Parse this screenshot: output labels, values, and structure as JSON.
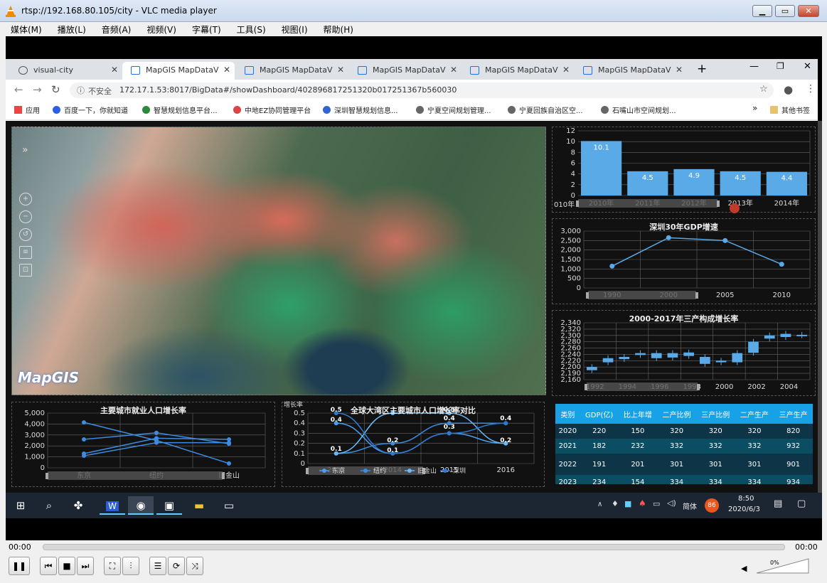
{
  "vlc": {
    "title": "rtsp://192.168.80.105/city - VLC media player",
    "menu": [
      "媒体(M)",
      "播放(L)",
      "音频(A)",
      "视频(V)",
      "字幕(T)",
      "工具(S)",
      "视图(I)",
      "帮助(H)"
    ],
    "time_left": "00:00",
    "time_right": "00:00",
    "volume": "0%"
  },
  "chrome": {
    "tabs": [
      {
        "label": "visual-city"
      },
      {
        "label": "MapGIS MapDataV"
      },
      {
        "label": "MapGIS MapDataV"
      },
      {
        "label": "MapGIS MapDataV"
      },
      {
        "label": "MapGIS MapDataV"
      },
      {
        "label": "MapGIS MapDataV"
      }
    ],
    "insecure": "不安全",
    "url": "172.17.1.53:8017/BigData#/showDashboard/402896817251320b017251367b560030",
    "bookmarks": [
      "应用",
      "百度一下，你就知道",
      "智慧规划信息平台...",
      "中地EZ协同管理平台",
      "深圳智慧规划信息...",
      "宁夏空间规划管理...",
      "宁夏回族自治区空...",
      "石嘴山市空间规划..."
    ],
    "more": "»",
    "other_bookmarks": "其他书签"
  },
  "map": {
    "logo": "MapGIS",
    "expand": "»"
  },
  "chart1": {
    "chart_data": {
      "type": "bar",
      "categories": [
        "2010年",
        "2011年",
        "2012年",
        "2013年",
        "2014年"
      ],
      "values": [
        10.1,
        4.5,
        4.9,
        4.5,
        4.4
      ],
      "ylim": [
        0,
        12
      ],
      "yticks": [
        "12",
        "10",
        "8",
        "6",
        "4",
        "2",
        "0"
      ]
    },
    "slider_label": "010年",
    "slider_label2": "2014年"
  },
  "chart2": {
    "title": "深圳30年GDP增速",
    "chart_data": {
      "type": "line",
      "categories": [
        "1990",
        "2000",
        "2005",
        "2010"
      ],
      "values": [
        1150,
        2650,
        2500,
        1250
      ],
      "ylim": [
        0,
        3000
      ],
      "yticks": [
        "3,000",
        "2,500",
        "2,000",
        "1,500",
        "1,000",
        "500",
        "0"
      ]
    }
  },
  "chart3": {
    "title": "2000-2017年三产构成增长率",
    "chart_data": {
      "type": "candlestick",
      "xticks": [
        "1992",
        "1994",
        "1996",
        "1998",
        "2000",
        "2002",
        "2004"
      ],
      "ylim": [
        2160,
        2340
      ],
      "yticks": [
        "2,340",
        "2,320",
        "2,300",
        "2,280",
        "2,260",
        "2,240",
        "2,220",
        "2,200",
        "2,190",
        "2,160"
      ],
      "candles": [
        [
          2190,
          2200
        ],
        [
          2215,
          2228
        ],
        [
          2225,
          2232
        ],
        [
          2238,
          2244
        ],
        [
          2228,
          2244
        ],
        [
          2230,
          2244
        ],
        [
          2235,
          2246
        ],
        [
          2210,
          2232
        ],
        [
          2215,
          2220
        ],
        [
          2215,
          2244
        ],
        [
          2245,
          2280
        ],
        [
          2290,
          2300
        ],
        [
          2295,
          2305
        ],
        [
          2300,
          2302
        ]
      ]
    }
  },
  "chart4": {
    "title": "主要城市就业人口增长率",
    "chart_data": {
      "type": "line",
      "categories": [
        "东京",
        "纽约",
        "旧金山"
      ],
      "yticks": [
        "5,000",
        "4,000",
        "3,000",
        "2,000",
        "1,000",
        "0"
      ],
      "ylim": [
        0,
        5000
      ],
      "series": [
        {
          "values": [
            4150,
            2500,
            400
          ]
        },
        {
          "values": [
            2600,
            3200,
            2200
          ]
        },
        {
          "values": [
            1300,
            2700,
            2600
          ]
        },
        {
          "values": [
            1100,
            2300,
            2300
          ]
        }
      ]
    }
  },
  "chart5": {
    "title": "全球大湾区主要城市人口增长率对比",
    "ylabel": "增长率",
    "chart_data": {
      "type": "line",
      "categories": [
        "2013",
        "2014",
        "2015",
        "2016"
      ],
      "yticks": [
        "0.5",
        "0.4",
        "0.3",
        "0.2",
        "0.1",
        "0"
      ],
      "ylim": [
        0,
        0.5
      ],
      "series": [
        {
          "name": "东京",
          "values": [
            0.4,
            0.1,
            0.3,
            0.2
          ]
        },
        {
          "name": "纽约",
          "values": [
            0.1,
            0.2,
            0.4,
            0.4
          ]
        },
        {
          "name": "旧金山",
          "values": [
            0.1,
            0.5,
            0.5,
            0.2
          ]
        },
        {
          "name": "深圳",
          "values": [
            0.5,
            0.1,
            0.3,
            0.4
          ]
        }
      ],
      "labels": [
        "0.5",
        "0.4",
        "0.1",
        "0.2",
        "0.1",
        "0.5",
        "0.3",
        "0.4",
        "0.4",
        "0.2"
      ]
    }
  },
  "table": {
    "headers": [
      "类别",
      "GDP(亿)",
      "比上年增",
      "二产比例",
      "三产比例",
      "二产生产",
      "三产生产"
    ],
    "rows": [
      [
        "2020",
        "220",
        "150",
        "320",
        "320",
        "320",
        "820"
      ],
      [
        "2021",
        "182",
        "232",
        "332",
        "332",
        "332",
        "932"
      ],
      [
        "2022",
        "191",
        "201",
        "301",
        "301",
        "301",
        "901"
      ],
      [
        "2023",
        "234",
        "154",
        "334",
        "334",
        "334",
        "934"
      ]
    ]
  },
  "taskbar": {
    "ime": "简体",
    "badge": "86",
    "time": "8:50",
    "date": "2020/6/3"
  }
}
